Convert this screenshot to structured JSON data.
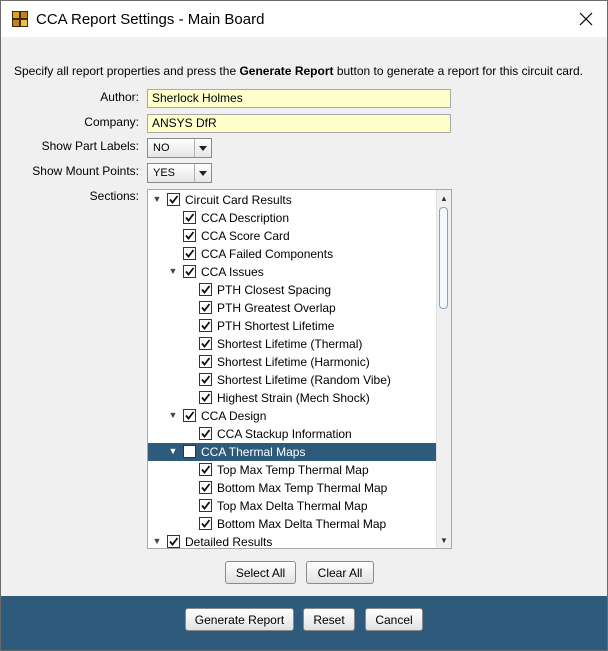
{
  "window": {
    "title": "CCA Report Settings - Main Board"
  },
  "instruction": {
    "prefix": "Specify all report properties and press the ",
    "bold": "Generate Report",
    "suffix": " button to generate a report for this circuit card."
  },
  "form": {
    "author_label": "Author:",
    "author_value": "Sherlock Holmes",
    "company_label": "Company:",
    "company_value": "ANSYS DfR",
    "part_labels_label": "Show Part Labels:",
    "part_labels_value": "NO",
    "mount_points_label": "Show Mount Points:",
    "mount_points_value": "YES",
    "sections_label": "Sections:"
  },
  "sections": [
    {
      "label": "Circuit Card Results",
      "level": 0,
      "expandable": true,
      "checked": true
    },
    {
      "label": "CCA Description",
      "level": 1,
      "expandable": false,
      "checked": true
    },
    {
      "label": "CCA Score Card",
      "level": 1,
      "expandable": false,
      "checked": true
    },
    {
      "label": "CCA Failed Components",
      "level": 1,
      "expandable": false,
      "checked": true
    },
    {
      "label": "CCA Issues",
      "level": 1,
      "expandable": true,
      "checked": true
    },
    {
      "label": "PTH Closest Spacing",
      "level": 2,
      "expandable": false,
      "checked": true
    },
    {
      "label": "PTH Greatest Overlap",
      "level": 2,
      "expandable": false,
      "checked": true
    },
    {
      "label": "PTH Shortest Lifetime",
      "level": 2,
      "expandable": false,
      "checked": true
    },
    {
      "label": "Shortest Lifetime (Thermal)",
      "level": 2,
      "expandable": false,
      "checked": true
    },
    {
      "label": "Shortest Lifetime (Harmonic)",
      "level": 2,
      "expandable": false,
      "checked": true
    },
    {
      "label": "Shortest Lifetime (Random Vibe)",
      "level": 2,
      "expandable": false,
      "checked": true
    },
    {
      "label": "Highest Strain (Mech Shock)",
      "level": 2,
      "expandable": false,
      "checked": true
    },
    {
      "label": "CCA Design",
      "level": 1,
      "expandable": true,
      "checked": true
    },
    {
      "label": "CCA Stackup Information",
      "level": 2,
      "expandable": false,
      "checked": true
    },
    {
      "label": "CCA Thermal Maps",
      "level": 1,
      "expandable": true,
      "checked": false,
      "selected": true
    },
    {
      "label": "Top Max Temp Thermal Map",
      "level": 2,
      "expandable": false,
      "checked": true
    },
    {
      "label": "Bottom Max Temp Thermal Map",
      "level": 2,
      "expandable": false,
      "checked": true
    },
    {
      "label": "Top Max Delta Thermal Map",
      "level": 2,
      "expandable": false,
      "checked": true
    },
    {
      "label": "Bottom Max Delta Thermal Map",
      "level": 2,
      "expandable": false,
      "checked": true
    },
    {
      "label": "Detailed Results",
      "level": 0,
      "expandable": true,
      "checked": true
    }
  ],
  "buttons": {
    "select_all": "Select All",
    "clear_all": "Clear All",
    "generate": "Generate Report",
    "reset": "Reset",
    "cancel": "Cancel"
  },
  "colors": {
    "footer": "#2e5b7b",
    "selection": "#2e5b7b",
    "field_bg": "#ffffcc"
  },
  "icons": {
    "app": "app-icon",
    "close": "close-icon",
    "expand": "triangle-down-icon",
    "check": "check-icon"
  }
}
